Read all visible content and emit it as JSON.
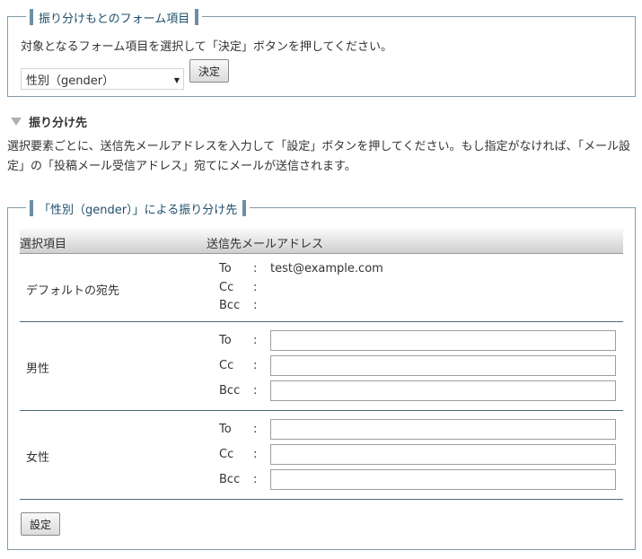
{
  "source_form": {
    "legend": "振り分けもとのフォーム項目",
    "instruction": "対象となるフォーム項目を選択して「決定」ボタンを押してください。",
    "selected_option": "性別（gender）",
    "decide_button": "決定"
  },
  "distribution": {
    "heading": "振り分け先",
    "description": "選択要素ごとに、送信先メールアドレスを入力して「設定」ボタンを押してください。もし指定がなければ、「メール設定」の「投稿メール受信アドレス」宛てにメールが送信されます。"
  },
  "table_section": {
    "legend": "「性別（gender）」による振り分け先",
    "headers": [
      "選択項目",
      "送信先メールアドレス"
    ],
    "default_row": {
      "label": "デフォルトの宛先",
      "to": "To",
      "cc": "Cc",
      "bcc": "Bcc",
      "to_value": "test@example.com",
      "colon": ":"
    },
    "rows": [
      {
        "label": "男性",
        "to": "To",
        "cc": "Cc",
        "bcc": "Bcc"
      },
      {
        "label": "女性",
        "to": "To",
        "cc": "Cc",
        "bcc": "Bcc"
      }
    ],
    "set_button": "設定"
  }
}
